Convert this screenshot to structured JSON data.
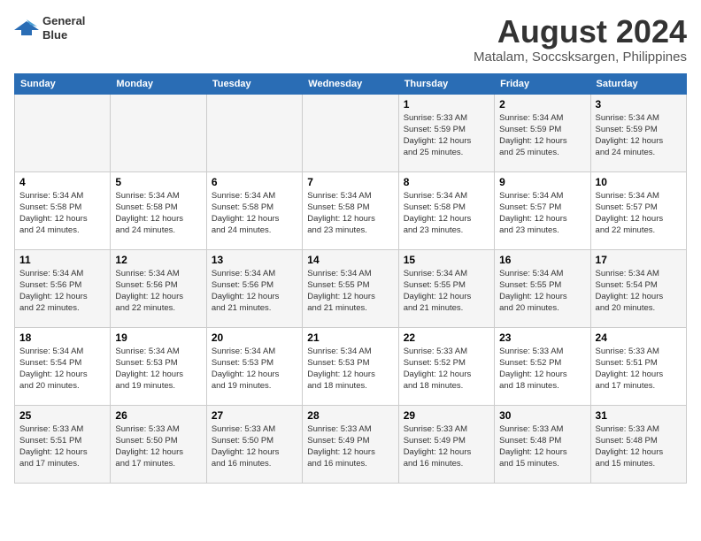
{
  "header": {
    "logo_line1": "General",
    "logo_line2": "Blue",
    "month_year": "August 2024",
    "location": "Matalam, Soccsksargen, Philippines"
  },
  "days_of_week": [
    "Sunday",
    "Monday",
    "Tuesday",
    "Wednesday",
    "Thursday",
    "Friday",
    "Saturday"
  ],
  "weeks": [
    [
      {
        "day": "",
        "info": ""
      },
      {
        "day": "",
        "info": ""
      },
      {
        "day": "",
        "info": ""
      },
      {
        "day": "",
        "info": ""
      },
      {
        "day": "1",
        "info": "Sunrise: 5:33 AM\nSunset: 5:59 PM\nDaylight: 12 hours\nand 25 minutes."
      },
      {
        "day": "2",
        "info": "Sunrise: 5:34 AM\nSunset: 5:59 PM\nDaylight: 12 hours\nand 25 minutes."
      },
      {
        "day": "3",
        "info": "Sunrise: 5:34 AM\nSunset: 5:59 PM\nDaylight: 12 hours\nand 24 minutes."
      }
    ],
    [
      {
        "day": "4",
        "info": "Sunrise: 5:34 AM\nSunset: 5:58 PM\nDaylight: 12 hours\nand 24 minutes."
      },
      {
        "day": "5",
        "info": "Sunrise: 5:34 AM\nSunset: 5:58 PM\nDaylight: 12 hours\nand 24 minutes."
      },
      {
        "day": "6",
        "info": "Sunrise: 5:34 AM\nSunset: 5:58 PM\nDaylight: 12 hours\nand 24 minutes."
      },
      {
        "day": "7",
        "info": "Sunrise: 5:34 AM\nSunset: 5:58 PM\nDaylight: 12 hours\nand 23 minutes."
      },
      {
        "day": "8",
        "info": "Sunrise: 5:34 AM\nSunset: 5:58 PM\nDaylight: 12 hours\nand 23 minutes."
      },
      {
        "day": "9",
        "info": "Sunrise: 5:34 AM\nSunset: 5:57 PM\nDaylight: 12 hours\nand 23 minutes."
      },
      {
        "day": "10",
        "info": "Sunrise: 5:34 AM\nSunset: 5:57 PM\nDaylight: 12 hours\nand 22 minutes."
      }
    ],
    [
      {
        "day": "11",
        "info": "Sunrise: 5:34 AM\nSunset: 5:56 PM\nDaylight: 12 hours\nand 22 minutes."
      },
      {
        "day": "12",
        "info": "Sunrise: 5:34 AM\nSunset: 5:56 PM\nDaylight: 12 hours\nand 22 minutes."
      },
      {
        "day": "13",
        "info": "Sunrise: 5:34 AM\nSunset: 5:56 PM\nDaylight: 12 hours\nand 21 minutes."
      },
      {
        "day": "14",
        "info": "Sunrise: 5:34 AM\nSunset: 5:55 PM\nDaylight: 12 hours\nand 21 minutes."
      },
      {
        "day": "15",
        "info": "Sunrise: 5:34 AM\nSunset: 5:55 PM\nDaylight: 12 hours\nand 21 minutes."
      },
      {
        "day": "16",
        "info": "Sunrise: 5:34 AM\nSunset: 5:55 PM\nDaylight: 12 hours\nand 20 minutes."
      },
      {
        "day": "17",
        "info": "Sunrise: 5:34 AM\nSunset: 5:54 PM\nDaylight: 12 hours\nand 20 minutes."
      }
    ],
    [
      {
        "day": "18",
        "info": "Sunrise: 5:34 AM\nSunset: 5:54 PM\nDaylight: 12 hours\nand 20 minutes."
      },
      {
        "day": "19",
        "info": "Sunrise: 5:34 AM\nSunset: 5:53 PM\nDaylight: 12 hours\nand 19 minutes."
      },
      {
        "day": "20",
        "info": "Sunrise: 5:34 AM\nSunset: 5:53 PM\nDaylight: 12 hours\nand 19 minutes."
      },
      {
        "day": "21",
        "info": "Sunrise: 5:34 AM\nSunset: 5:53 PM\nDaylight: 12 hours\nand 18 minutes."
      },
      {
        "day": "22",
        "info": "Sunrise: 5:33 AM\nSunset: 5:52 PM\nDaylight: 12 hours\nand 18 minutes."
      },
      {
        "day": "23",
        "info": "Sunrise: 5:33 AM\nSunset: 5:52 PM\nDaylight: 12 hours\nand 18 minutes."
      },
      {
        "day": "24",
        "info": "Sunrise: 5:33 AM\nSunset: 5:51 PM\nDaylight: 12 hours\nand 17 minutes."
      }
    ],
    [
      {
        "day": "25",
        "info": "Sunrise: 5:33 AM\nSunset: 5:51 PM\nDaylight: 12 hours\nand 17 minutes."
      },
      {
        "day": "26",
        "info": "Sunrise: 5:33 AM\nSunset: 5:50 PM\nDaylight: 12 hours\nand 17 minutes."
      },
      {
        "day": "27",
        "info": "Sunrise: 5:33 AM\nSunset: 5:50 PM\nDaylight: 12 hours\nand 16 minutes."
      },
      {
        "day": "28",
        "info": "Sunrise: 5:33 AM\nSunset: 5:49 PM\nDaylight: 12 hours\nand 16 minutes."
      },
      {
        "day": "29",
        "info": "Sunrise: 5:33 AM\nSunset: 5:49 PM\nDaylight: 12 hours\nand 16 minutes."
      },
      {
        "day": "30",
        "info": "Sunrise: 5:33 AM\nSunset: 5:48 PM\nDaylight: 12 hours\nand 15 minutes."
      },
      {
        "day": "31",
        "info": "Sunrise: 5:33 AM\nSunset: 5:48 PM\nDaylight: 12 hours\nand 15 minutes."
      }
    ]
  ]
}
